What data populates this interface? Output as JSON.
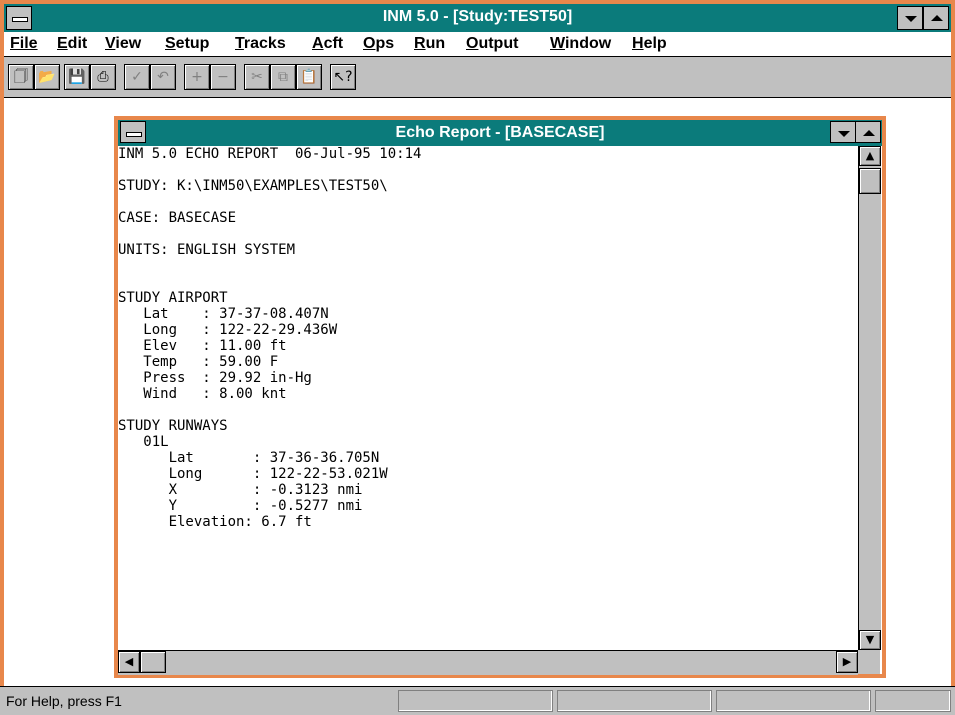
{
  "window": {
    "title": "INM 5.0 - [Study:TEST50]"
  },
  "menu": [
    "File",
    "Edit",
    "View",
    "Setup",
    "Tracks",
    "Acft",
    "Ops",
    "Run",
    "Output",
    "Window",
    "Help"
  ],
  "toolbar": {
    "icons": [
      "new-file-icon",
      "open-folder-icon",
      "save-disk-icon",
      "print-icon",
      "check-icon",
      "undo-icon",
      "add-icon",
      "remove-icon",
      "cut-icon",
      "copy-icon",
      "paste-icon",
      "context-help-icon"
    ]
  },
  "child": {
    "title": "Echo Report - [BASECASE]"
  },
  "report": {
    "lines": [
      "INM 5.0 ECHO REPORT  06-Jul-95 10:14",
      "",
      "STUDY: K:\\INM50\\EXAMPLES\\TEST50\\",
      "",
      "CASE: BASECASE",
      "",
      "UNITS: ENGLISH SYSTEM",
      "",
      "",
      "STUDY AIRPORT",
      "   Lat    : 37-37-08.407N",
      "   Long   : 122-22-29.436W",
      "   Elev   : 11.00 ft",
      "   Temp   : 59.00 F",
      "   Press  : 29.92 in-Hg",
      "   Wind   : 8.00 knt",
      "",
      "STUDY RUNWAYS",
      "   01L",
      "      Lat       : 37-36-36.705N",
      "      Long      : 122-22-53.021W",
      "      X         : -0.3123 nmi",
      "      Y         : -0.5277 nmi",
      "      Elevation: 6.7 ft"
    ]
  },
  "status": {
    "text": "For Help, press F1"
  },
  "colors": {
    "titlebar": "#0b7b7b",
    "border": "#e8874b",
    "face": "#c0c0c0"
  }
}
